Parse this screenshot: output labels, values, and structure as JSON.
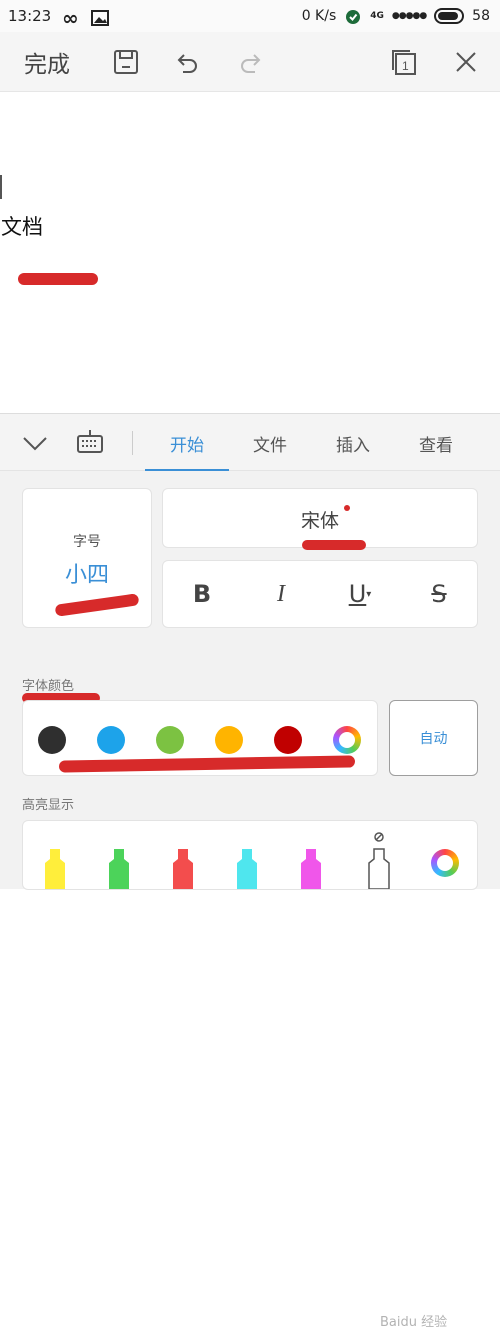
{
  "status": {
    "time": "13:23",
    "speed": "0 K/s",
    "network": "4G",
    "battery": "58"
  },
  "toolbar": {
    "done": "完成"
  },
  "document": {
    "text": "文档"
  },
  "tabs": [
    {
      "label": "开始",
      "active": true
    },
    {
      "label": "文件",
      "active": false
    },
    {
      "label": "插入",
      "active": false
    },
    {
      "label": "查看",
      "active": false
    }
  ],
  "font": {
    "size_label": "字号",
    "size_value": "小四",
    "family": "宋体"
  },
  "format": {
    "bold": "B",
    "italic": "I",
    "underline": "U",
    "strike": "S"
  },
  "font_color": {
    "label": "字体颜色",
    "swatches": [
      "#2f2f2f",
      "#1da3ea",
      "#7cc242",
      "#ffb400",
      "#c00000"
    ],
    "auto": "自动"
  },
  "highlight": {
    "label": "高亮显示",
    "colors": [
      "#ffee3b",
      "#4cd35a",
      "#f34d4d",
      "#4fe6ee",
      "#f056ea"
    ]
  },
  "watermark": "Baidu 经验"
}
